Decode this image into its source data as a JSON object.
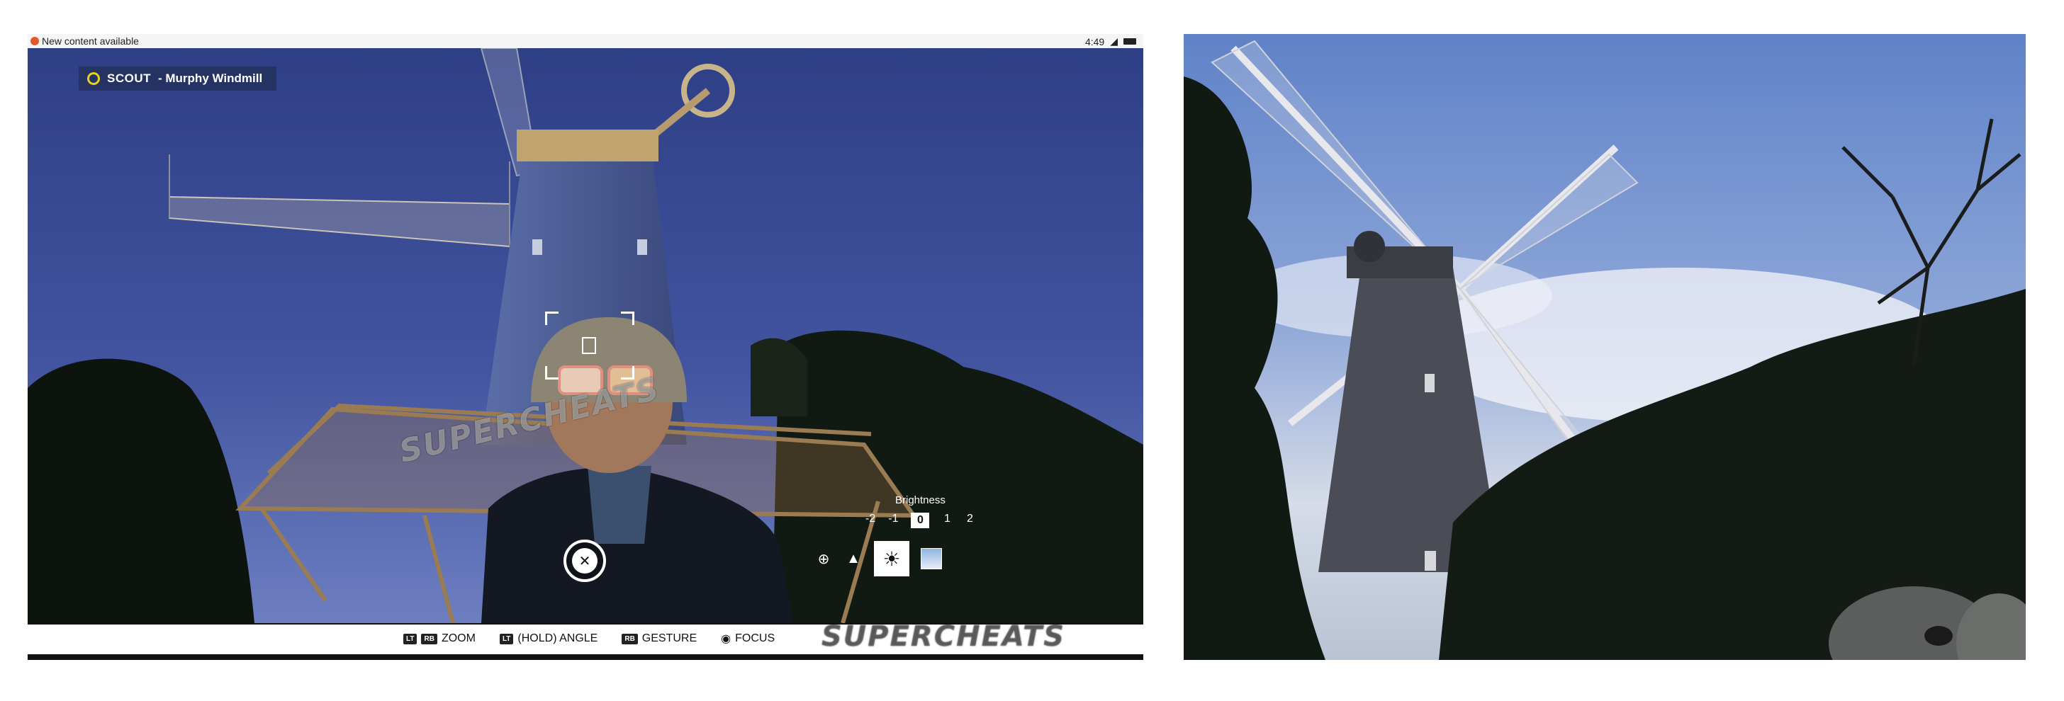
{
  "status_bar": {
    "notification": "New content available",
    "time": "4:49"
  },
  "hud": {
    "scout_brand": "SCOUT",
    "scout_location": "- Murphy Windmill",
    "brightness": {
      "title": "Brightness",
      "options": [
        "-2",
        "-1",
        "0",
        "1",
        "2"
      ],
      "selected": "0"
    },
    "controls": [
      {
        "key": "LT",
        "key2": "RB",
        "label": "ZOOM"
      },
      {
        "key": "LT",
        "label": "(HOLD) ANGLE"
      },
      {
        "key": "RB",
        "label": "GESTURE"
      },
      {
        "key": "◉",
        "label": "FOCUS"
      }
    ],
    "watermark": "SUPERCHEATS"
  },
  "photo": {
    "subject": "windmill"
  },
  "colors": {
    "scout_accent": "#e8d21a",
    "hud_text": "#ffffff",
    "sky_left": "#3a4c8f",
    "sky_right": "#7d9cd6"
  }
}
